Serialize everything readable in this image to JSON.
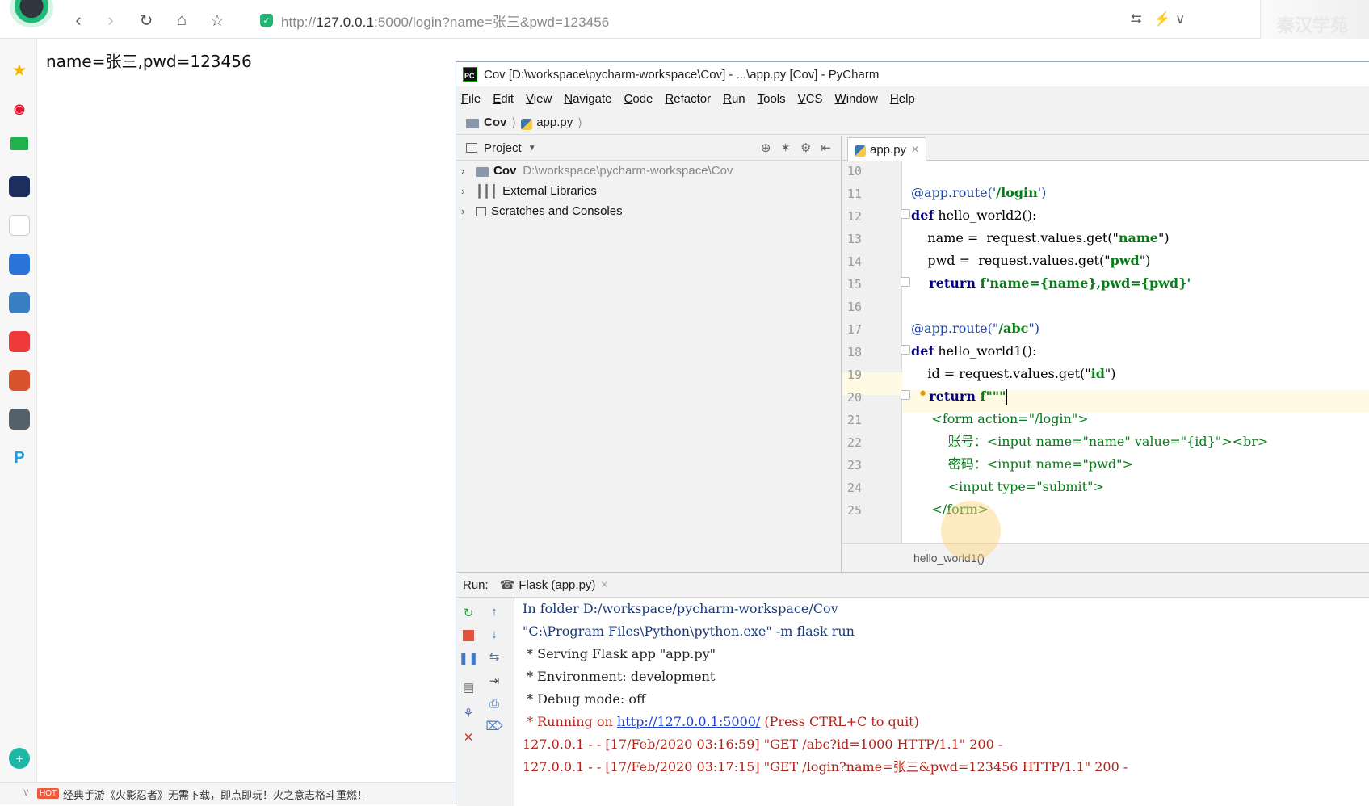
{
  "browser": {
    "url_prefix": "http://",
    "url_host": "127.0.0.1",
    "url_rest": ":5000/login?name=张三&pwd=123456",
    "watermark": "秦汉学苑"
  },
  "page": {
    "content": "name=张三,pwd=123456"
  },
  "status_bar": {
    "badge": "HOT",
    "ad_text": "经典手游《火影忍者》无需下载，即点即玩！火之意志格斗重燃！"
  },
  "pycharm": {
    "title": "Cov [D:\\workspace\\pycharm-workspace\\Cov] - ...\\app.py [Cov] - PyCharm",
    "menu": [
      {
        "u": "F",
        "rest": "ile"
      },
      {
        "u": "E",
        "rest": "dit"
      },
      {
        "u": "V",
        "rest": "iew"
      },
      {
        "u": "N",
        "rest": "avigate"
      },
      {
        "u": "C",
        "rest": "ode"
      },
      {
        "u": "R",
        "rest": "efactor"
      },
      {
        "u": "R",
        "rest": "un"
      },
      {
        "u": "T",
        "rest": "ools"
      },
      {
        "u": "V",
        "rest": "CS"
      },
      {
        "u": "W",
        "rest": "indow"
      },
      {
        "u": "H",
        "rest": "elp"
      }
    ],
    "breadcrumb": {
      "project": "Cov",
      "file": "app.py"
    },
    "project_panel": {
      "title": "Project",
      "tree": [
        {
          "label": "Cov",
          "path": "D:\\workspace\\pycharm-workspace\\Cov"
        },
        {
          "label": "External Libraries",
          "path": ""
        },
        {
          "label": "Scratches and Consoles",
          "path": ""
        }
      ]
    },
    "editor": {
      "tab": "app.py",
      "line_numbers": [
        "10",
        "11",
        "12",
        "13",
        "14",
        "15",
        "16",
        "17",
        "18",
        "19",
        "20",
        "21",
        "22",
        "23",
        "24",
        "25"
      ],
      "lines": {
        "l11_deco": "@app.route('",
        "l11_str": "/login",
        "l11_end": "')",
        "l12_kw": "def",
        "l12_rest": " hello_world2():",
        "l13_a": "    name =  request.values.get(\"",
        "l13_s": "name",
        "l13_b": "\")",
        "l14_a": "    pwd =  request.values.get(\"",
        "l14_s": "pwd",
        "l14_b": "\")",
        "l15_kw": "    return",
        "l15_s": " f'name={name},pwd={pwd}'",
        "l17_deco": "@app.route(\"",
        "l17_str": "/abc",
        "l17_end": "\")",
        "l18_kw": "def",
        "l18_rest": " hello_world1():",
        "l19_a": "    id = request.values.get(\"",
        "l19_s": "id",
        "l19_b": "\")",
        "l20_kw": "    return",
        "l20_s": " f\"\"\"",
        "l21": "     <form action=\"/login\">",
        "l22": "         账号：<input name=\"name\" value=\"{id}\"><br>",
        "l23": "         密码：<input name=\"pwd\">",
        "l24": "         <input type=\"submit\">",
        "l25": "     </form>"
      },
      "footer": "hello_world1()"
    },
    "run": {
      "label": "Run:",
      "tab": "Flask (app.py)",
      "console": {
        "c1": "In folder D:/workspace/pycharm-workspace/Cov",
        "c2": "\"C:\\Program Files\\Python\\python.exe\" -m flask run",
        "c3": " * Serving Flask app \"app.py\"",
        "c4": " * Environment: development",
        "c5": " * Debug mode: off",
        "c6a": " * Running on ",
        "c6link": "http://127.0.0.1:5000/",
        "c6b": " (Press CTRL+C to quit)",
        "c7": "127.0.0.1 - - [17/Feb/2020 03:16:59] \"GET /abc?id=1000 HTTP/1.1\" 200 -",
        "c8": "127.0.0.1 - - [17/Feb/2020 03:17:15] \"GET /login?name=张三&pwd=123456 HTTP/1.1\" 200 -"
      }
    }
  },
  "colors": {
    "keyword": "#000080",
    "string": "#067d17",
    "decorator": "#1d43a6",
    "console_red": "#b0241c",
    "console_blue": "#1b3a78"
  }
}
